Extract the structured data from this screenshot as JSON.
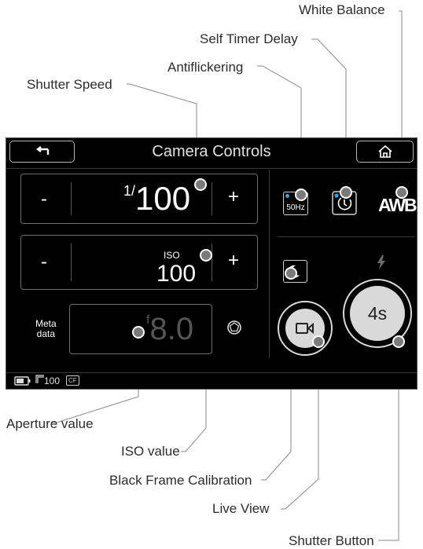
{
  "callouts": {
    "white_balance": "White Balance",
    "self_timer": "Self Timer Delay",
    "antiflicker": "Antiflickering",
    "shutter_speed": "Shutter Speed",
    "aperture": "Aperture value",
    "iso": "ISO value",
    "black_frame": "Black Frame Calibration",
    "live_view": "Live View",
    "shutter_button": "Shutter Button"
  },
  "screen": {
    "title": "Camera Controls",
    "back_icon": "back-arrow-icon",
    "home_icon": "home-icon"
  },
  "shutter": {
    "minus": "-",
    "plus": "+",
    "prefix": "1/",
    "value": "100"
  },
  "iso": {
    "minus": "-",
    "plus": "+",
    "label": "ISO",
    "value": "100"
  },
  "aperture": {
    "meta_line1": "Meta",
    "meta_line2": "data",
    "prefix": "f",
    "value": "8.0",
    "icon": "aperture-icon"
  },
  "right": {
    "antiflicker": "50Hz",
    "timer_icon": "self-timer-icon",
    "awb": "AWB",
    "black_frame_icon": "moon-icon",
    "flash_icon": "flash-icon",
    "live_view_icon": "video-camera-icon",
    "shutter_button": "4s"
  },
  "status": {
    "battery_icon": "battery-icon",
    "count": "100",
    "card": "CF"
  },
  "colors": {
    "accent": "#2aa7e8",
    "background": "#000000",
    "button": "#d9d9d9"
  }
}
